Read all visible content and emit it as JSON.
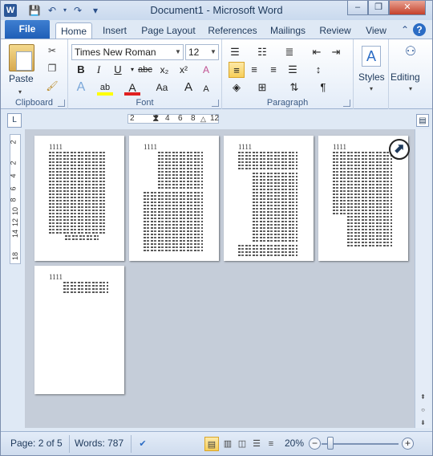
{
  "window": {
    "title": "Document1 - Microsoft Word",
    "app_icon": "W",
    "minimize_icon": "–",
    "restore_icon": "❐",
    "close_icon": "✕"
  },
  "qat": {
    "save_icon": "💾",
    "undo_icon": "↶",
    "redo_icon": "↷",
    "customize_icon": "▾"
  },
  "tabs": {
    "file": "File",
    "items": [
      {
        "label": "Home"
      },
      {
        "label": "Insert"
      },
      {
        "label": "Page Layout"
      },
      {
        "label": "References"
      },
      {
        "label": "Mailings"
      },
      {
        "label": "Review"
      },
      {
        "label": "View"
      }
    ],
    "minimize_ribbon_icon": "⌃",
    "help_icon": "?"
  },
  "ribbon": {
    "clipboard": {
      "label": "Clipboard",
      "paste": "Paste"
    },
    "font": {
      "label": "Font",
      "font_name": "Times New Roman",
      "font_size": "12",
      "bold": "B",
      "italic": "I",
      "underline": "U",
      "strike": "abc",
      "subscript": "x₂",
      "superscript": "x²",
      "text_effects": "A",
      "highlight": "ab",
      "font_color": "A",
      "change_case": "Aa",
      "grow": "A",
      "shrink": "A",
      "clear": "A"
    },
    "paragraph": {
      "label": "Paragraph",
      "show_marks": "¶"
    },
    "styles": {
      "label": "Styles"
    },
    "editing": {
      "label": "Editing"
    }
  },
  "ruler": {
    "ticks": [
      "2",
      "2",
      "4",
      "6",
      "8",
      "12"
    ]
  },
  "vruler": {
    "ticks": [
      "2",
      "2",
      "4",
      "6",
      "8",
      "10",
      "12",
      "14",
      "18"
    ]
  },
  "pages": [
    {
      "num": "1111"
    },
    {
      "num": "1111"
    },
    {
      "num": "1111"
    },
    {
      "num": "1111"
    },
    {
      "num": "1111"
    }
  ],
  "status": {
    "page": "Page: 2 of 5",
    "words": "Words: 787",
    "zoom": "20%"
  },
  "colors": {
    "accent": "#2b5797",
    "file_tab": "#1f5fb7",
    "canvas": "#c5cdd9",
    "selected": "#f7cf5a"
  }
}
